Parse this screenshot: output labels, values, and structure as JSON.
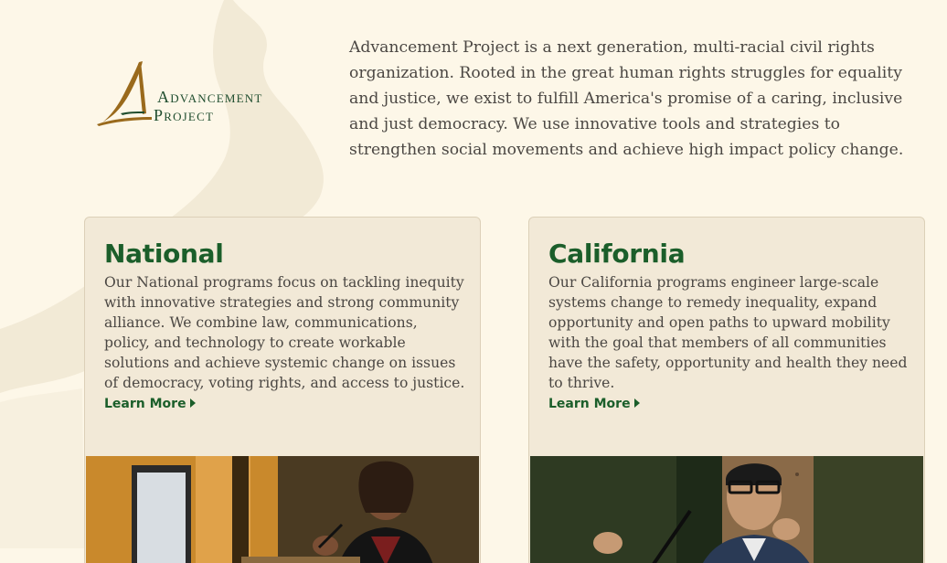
{
  "brand": {
    "logo_line1": "Advancement",
    "logo_line2": "Project"
  },
  "intro": {
    "text": "Advancement Project is a next generation, multi-racial civil rights organization. Rooted in the great human rights struggles for equality and justice, we exist to fulfill America's promise of a caring, inclusive and just democracy. We use innovative tools and strategies to strengthen social movements and achieve high impact policy change."
  },
  "cards": [
    {
      "title": "National",
      "body": "Our National programs focus on tackling inequity with innovative strategies and strong community alliance. We combine law, communications, policy, and technology to create workable solutions and achieve systemic change on issues of democracy, voting rights, and access to justice.",
      "link": "Learn More"
    },
    {
      "title": "California",
      "body": "Our California programs engineer large-scale systems change to remedy inequality, expand opportunity and open paths to upward mobility with the goal that members of all communities have the safety, opportunity and health they need to thrive.",
      "link": "Learn More"
    }
  ],
  "colors": {
    "background": "#fdf7e8",
    "card": "#f2e9d7",
    "accent_green": "#1b5e2a",
    "logo_brown": "#9a6a1c",
    "text": "#4b4743"
  },
  "icons": {
    "learn_more": "caret-right-icon"
  }
}
